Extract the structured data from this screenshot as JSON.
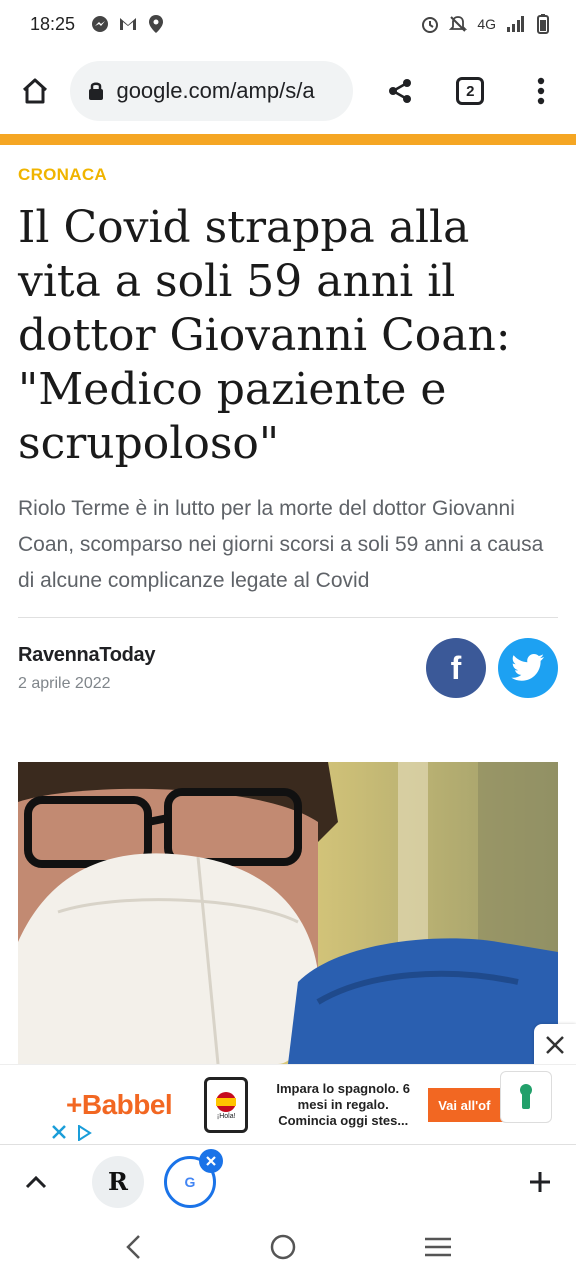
{
  "status_bar": {
    "time": "18:25",
    "left_icons": [
      "messenger-icon",
      "gmail-icon",
      "location-icon"
    ],
    "network": "4G",
    "right_icons": [
      "alarm-icon",
      "mute-icon",
      "signal-icon",
      "battery-icon"
    ]
  },
  "browser": {
    "url": "google.com/amp/s/a",
    "tab_count": "2",
    "accent_color": "#f5a623"
  },
  "article": {
    "category": "CRONACA",
    "headline": "Il Covid strappa alla vita a soli 59 anni il dottor Giovanni Coan: \"Medico paziente e scrupoloso\"",
    "lead": "Riolo Terme è in lutto per la morte del dottor Giovanni Coan, scomparso nei giorni scorsi a soli 59 anni a causa di alcune complicanze legate al Covid",
    "source": "RavennaToday",
    "date": "2 aprile 2022",
    "share": {
      "facebook_glyph": "f",
      "twitter_color": "#1da1f2",
      "facebook_color": "#3b5998"
    }
  },
  "ad": {
    "brand": "+Babbel",
    "phone_text": "¡Hola!",
    "copy": "Impara lo spagnolo. 6 mesi in regalo. Comincia oggi stes...",
    "cta": "Vai all'of",
    "brand_color": "#f26722"
  },
  "bottom_bar": {
    "favicon_letter": "R",
    "google_letter": "G"
  }
}
